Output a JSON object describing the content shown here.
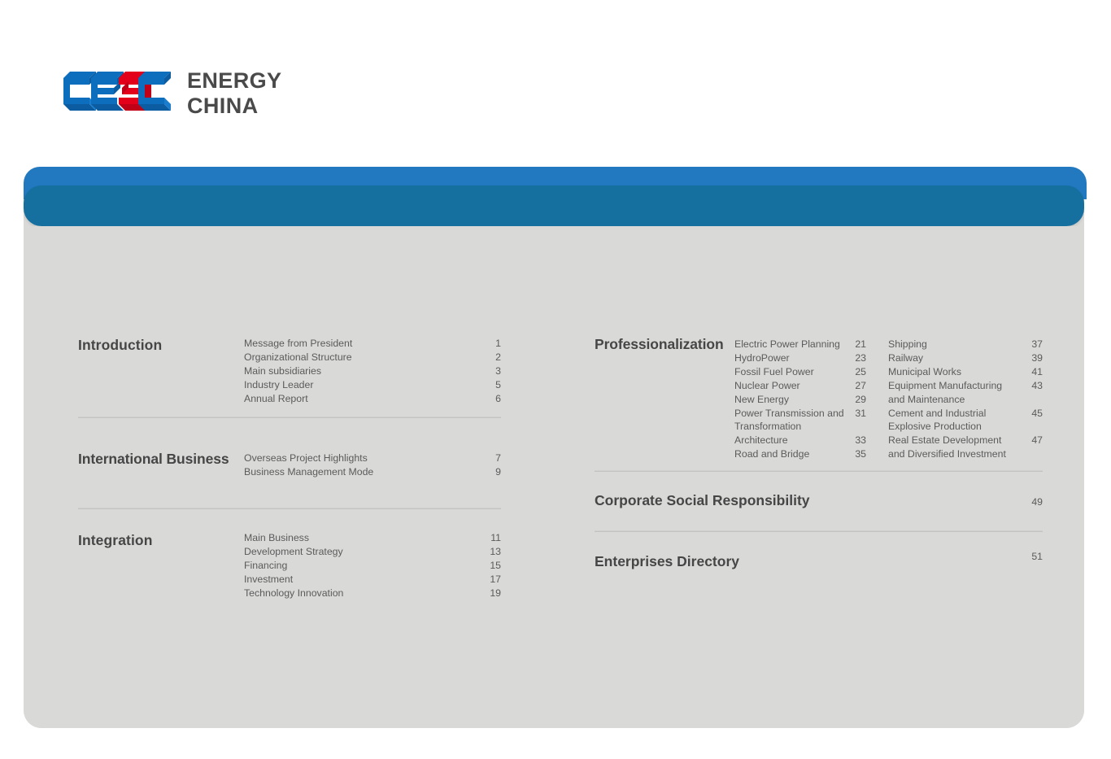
{
  "brand": {
    "logo_mark_name": "cec-logo",
    "wordmark_line1": "ENERGY",
    "wordmark_line2": "CHINA",
    "colors": {
      "logo_blue": "#0d6ebd",
      "logo_blue_dark": "#0b5ca0",
      "logo_red": "#e2001a",
      "logo_red_dark": "#c00016",
      "wordmark": "#4a4a4a",
      "bar_light": "#2279c0",
      "bar_dark": "#16709f",
      "panel": "#d9d9d7",
      "text": "#5b5b5b",
      "heading": "#464646",
      "divider": "#c3c3c1"
    }
  },
  "toc": {
    "left": [
      {
        "heading": "Introduction",
        "entries": [
          {
            "title": "Message from President",
            "page": "1"
          },
          {
            "title": "Organizational Structure",
            "page": "2"
          },
          {
            "title": "Main subsidiaries",
            "page": "3"
          },
          {
            "title": "Industry Leader",
            "page": "5"
          },
          {
            "title": "Annual Report",
            "page": "6"
          }
        ]
      },
      {
        "heading": "International Business",
        "entries": [
          {
            "title": "Overseas Project Highlights",
            "page": "7"
          },
          {
            "title": "Business Management Mode",
            "page": "9"
          }
        ]
      },
      {
        "heading": "Integration",
        "entries": [
          {
            "title": "Main Business",
            "page": "11"
          },
          {
            "title": "Development Strategy",
            "page": "13"
          },
          {
            "title": "Financing",
            "page": "15"
          },
          {
            "title": "Investment",
            "page": "17"
          },
          {
            "title": "Technology Innovation",
            "page": "19"
          }
        ]
      }
    ],
    "right": {
      "professionalization": {
        "heading": "Professionalization",
        "column_a": [
          {
            "title": "Electric Power Planning",
            "page": "21",
            "cont": false
          },
          {
            "title": "HydroPower",
            "page": "23",
            "cont": false
          },
          {
            "title": "Fossil Fuel Power",
            "page": "25",
            "cont": false
          },
          {
            "title": "Nuclear Power",
            "page": "27",
            "cont": false
          },
          {
            "title": "New Energy",
            "page": "29",
            "cont": false
          },
          {
            "title": "Power Transmission and",
            "page": "31",
            "cont": false
          },
          {
            "title": "Transformation",
            "page": "",
            "cont": true
          },
          {
            "title": "Architecture",
            "page": "33",
            "cont": false
          },
          {
            "title": "Road and Bridge",
            "page": "35",
            "cont": false
          }
        ],
        "column_b": [
          {
            "title": "Shipping",
            "page": "37",
            "cont": false
          },
          {
            "title": "Railway",
            "page": "39",
            "cont": false
          },
          {
            "title": "Municipal Works",
            "page": "41",
            "cont": false
          },
          {
            "title": "Equipment Manufacturing",
            "page": "43",
            "cont": false
          },
          {
            "title": "and Maintenance",
            "page": "",
            "cont": true
          },
          {
            "title": "Cement and Industrial",
            "page": "45",
            "cont": false
          },
          {
            "title": "Explosive Production",
            "page": "",
            "cont": true
          },
          {
            "title": "Real Estate Development",
            "page": "47",
            "cont": false
          },
          {
            "title": "and Diversified Investment",
            "page": "",
            "cont": true
          }
        ]
      },
      "standalone": [
        {
          "title": "Corporate Social Responsibility",
          "page": "49"
        },
        {
          "title": "Enterprises Directory",
          "page": "51"
        }
      ]
    }
  }
}
